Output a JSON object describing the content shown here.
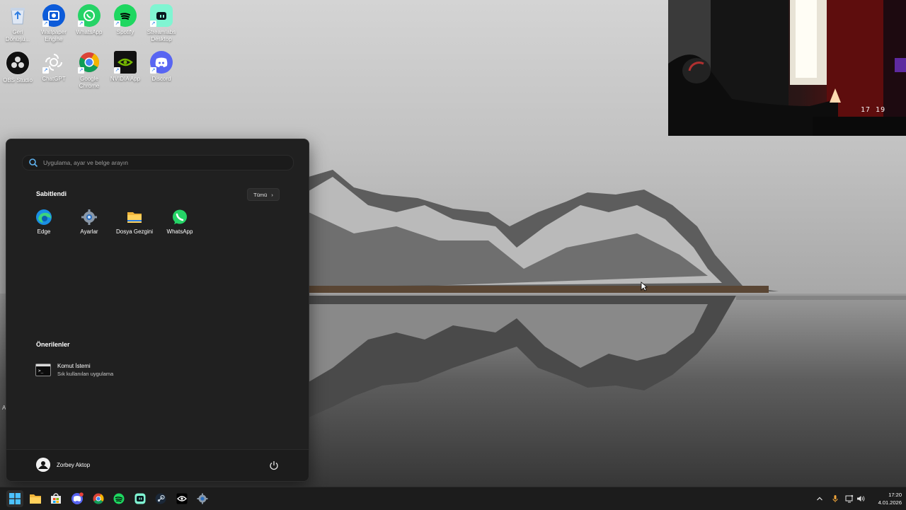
{
  "desktop": {
    "icons": [
      {
        "label": "Geri Dönüşü...",
        "icon": "recycle-bin-icon"
      },
      {
        "label": "Wallpaper Engine",
        "icon": "wallpaper-engine-icon"
      },
      {
        "label": "WhatsApp",
        "icon": "whatsapp-icon"
      },
      {
        "label": "Spotify",
        "icon": "spotify-icon"
      },
      {
        "label": "Streamlabs Desktop",
        "icon": "streamlabs-icon"
      },
      {
        "label": "OBS Studio",
        "icon": "obs-icon"
      },
      {
        "label": "ChatGPT",
        "icon": "chatgpt-icon"
      },
      {
        "label": "Google Chrome",
        "icon": "chrome-icon"
      },
      {
        "label": "NVIDIA App",
        "icon": "nvidia-icon"
      },
      {
        "label": "Discord",
        "icon": "discord-icon"
      }
    ]
  },
  "webcam": {
    "clock_text": "17 19"
  },
  "start_menu": {
    "search": {
      "placeholder": "Uygulama, ayar ve belge arayın"
    },
    "pinned": {
      "title": "Sabitlendi",
      "all_label": "Tümü",
      "items": [
        {
          "label": "Edge",
          "icon": "edge-icon"
        },
        {
          "label": "Ayarlar",
          "icon": "settings-gear-icon"
        },
        {
          "label": "Dosya Gezgini",
          "icon": "file-explorer-icon"
        },
        {
          "label": "WhatsApp",
          "icon": "whatsapp-icon"
        }
      ]
    },
    "recommended": {
      "title": "Önerilenler",
      "items": [
        {
          "title": "Komut İstemi",
          "subtitle": "Sık kullanılan uygulama",
          "icon": "command-prompt-icon"
        }
      ]
    },
    "user": {
      "name": "Zorbey Aktop"
    }
  },
  "taskbar": {
    "apps": [
      "start-icon",
      "file-explorer-icon",
      "microsoft-store-icon",
      "discord-icon",
      "chrome-icon",
      "spotify-icon",
      "streamlabs-icon",
      "steam-icon",
      "nvidia-icon",
      "settings-gear-icon"
    ],
    "clock": {
      "time": "17:20",
      "date": "4.01.2026"
    }
  },
  "colors": {
    "start_bg": "#202020",
    "taskbar_bg": "#1c1c1c",
    "accent": "#0078d4"
  }
}
